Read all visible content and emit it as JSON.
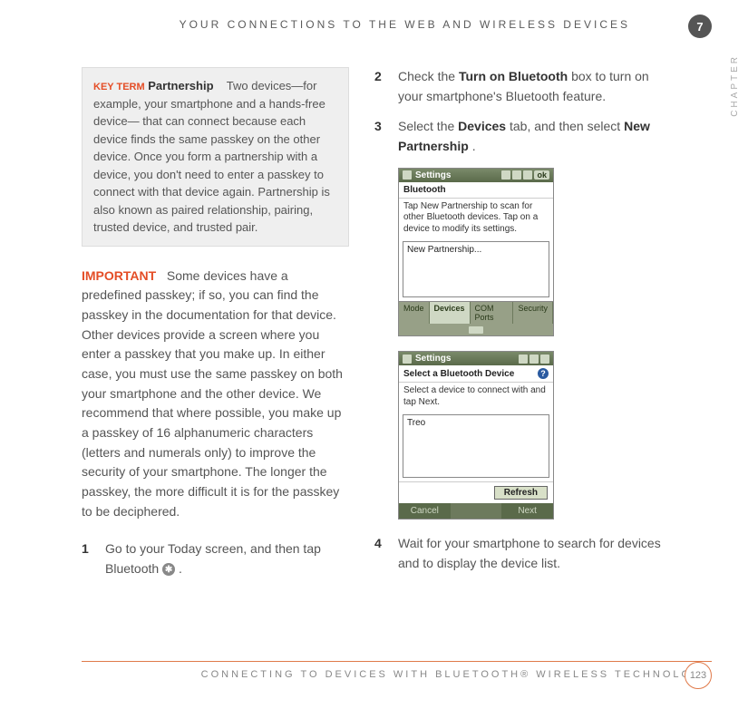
{
  "header": {
    "running_title": "YOUR CONNECTIONS TO THE WEB AND WIRELESS DEVICES",
    "chapter_number": "7",
    "chapter_label": "CHAPTER"
  },
  "keyterm": {
    "label": "KEY TERM",
    "term": "Partnership",
    "definition": "Two devices—for example, your smartphone and a hands-free device— that can connect because each device finds the same passkey on the other device. Once you form a partnership with a device, you don't need to enter a passkey to connect with that device again. Partnership is also known as paired relationship, pairing, trusted device, and trusted pair."
  },
  "important": {
    "label": "IMPORTANT",
    "text": "Some devices have a predefined passkey; if so, you can find the passkey in the documentation for that device. Other devices provide a screen where you enter a passkey that you make up. In either case, you must use the same passkey on both your smartphone and the other device. We recommend that where possible, you make up a passkey of 16 alphanumeric characters (letters and numerals only) to improve the security of your smartphone. The longer the passkey, the more difficult it is for the passkey to be deciphered."
  },
  "steps_left": {
    "s1": {
      "num": "1",
      "pre": "Go to your Today screen, and then tap Bluetooth ",
      "glyph_label": "bluetooth-icon",
      "post": "."
    }
  },
  "steps_right": {
    "s2": {
      "num": "2",
      "pre": "Check the ",
      "bold1": "Turn on Bluetooth",
      "post": " box to turn on your smartphone's Bluetooth feature."
    },
    "s3": {
      "num": "3",
      "pre": "Select the ",
      "bold1": "Devices",
      "mid": " tab, and then select ",
      "bold2": "New Partnership",
      "post": "."
    },
    "s4": {
      "num": "4",
      "text": "Wait for your smartphone to search for devices and to display the device list."
    }
  },
  "screenshot1": {
    "title": "Settings",
    "ok": "ok",
    "subhead": "Bluetooth",
    "blurb": "Tap New Partnership to scan for other Bluetooth devices. Tap on a device to modify its settings.",
    "list_item": "New Partnership...",
    "tabs": [
      "Mode",
      "Devices",
      "COM Ports",
      "Security"
    ],
    "active_tab_index": 1
  },
  "screenshot2": {
    "title": "Settings",
    "subhead": "Select a Bluetooth Device",
    "help_glyph": "?",
    "blurb": "Select a device to connect with and tap Next.",
    "list_item": "Treo",
    "refresh": "Refresh",
    "bottombar": [
      "Cancel",
      "",
      "Next"
    ]
  },
  "footer": {
    "text": "CONNECTING TO DEVICES WITH BLUETOOTH® WIRELESS TECHNOLOGY",
    "page_number": "123"
  }
}
